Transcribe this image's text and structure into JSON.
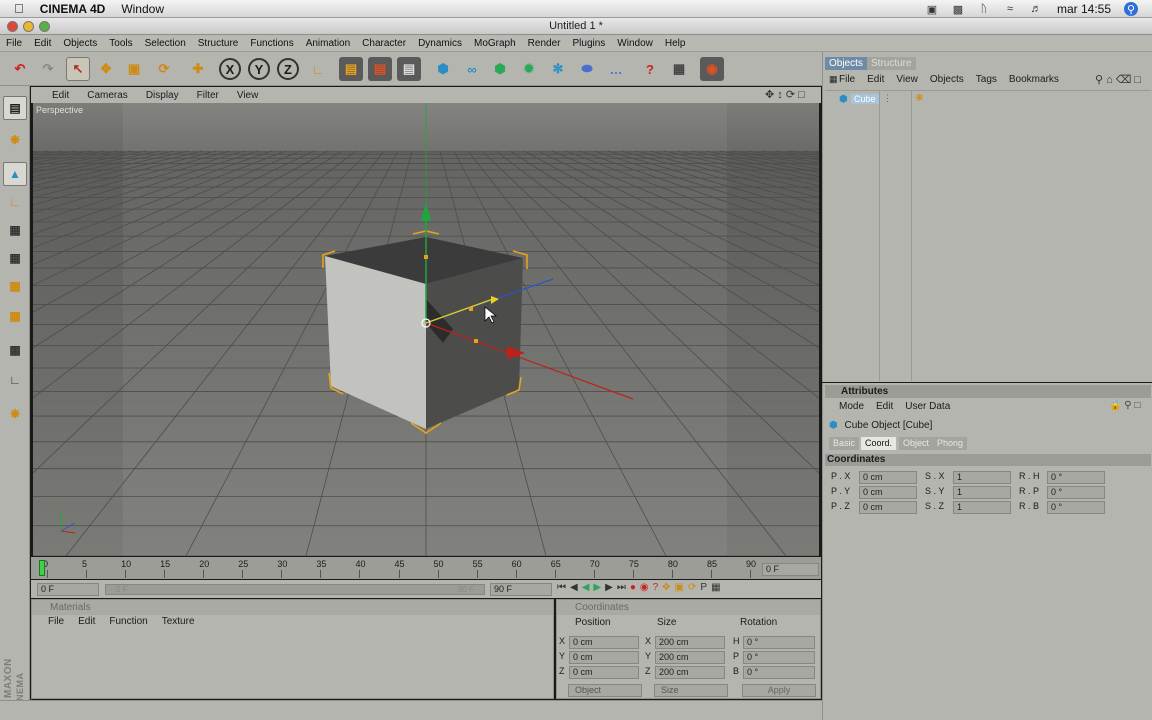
{
  "mac_menubar": {
    "app_name": "CINEMA 4D",
    "menu": "Window",
    "clock": "mar 14:55"
  },
  "window": {
    "title": "Untitled 1 *"
  },
  "app_menu": [
    "File",
    "Edit",
    "Objects",
    "Tools",
    "Selection",
    "Structure",
    "Functions",
    "Animation",
    "Character",
    "Dynamics",
    "MoGraph",
    "Render",
    "Plugins",
    "Window",
    "Help"
  ],
  "viewport": {
    "menu": [
      "Edit",
      "Cameras",
      "Display",
      "Filter",
      "View"
    ],
    "label": "Perspective"
  },
  "timeline": {
    "ticks": [
      "0",
      "5",
      "10",
      "15",
      "20",
      "25",
      "30",
      "35",
      "40",
      "45",
      "50",
      "55",
      "60",
      "65",
      "70",
      "75",
      "80",
      "85",
      "90"
    ],
    "current_frame": "0 F",
    "start_frame": "0 F",
    "end_frame": "90 F",
    "range_start": "0 F",
    "range_end": "90 F"
  },
  "materials_panel": {
    "title": "Materials",
    "menu": [
      "File",
      "Edit",
      "Function",
      "Texture"
    ]
  },
  "coordinates_panel": {
    "title": "Coordinates",
    "col_position": "Position",
    "col_size": "Size",
    "col_rotation": "Rotation",
    "rows": [
      {
        "axis": "X",
        "pos": "0 cm",
        "size_axis": "X",
        "size": "200 cm",
        "rot_axis": "H",
        "rot": "0 °"
      },
      {
        "axis": "Y",
        "pos": "0 cm",
        "size_axis": "Y",
        "size": "200 cm",
        "rot_axis": "P",
        "rot": "0 °"
      },
      {
        "axis": "Z",
        "pos": "0 cm",
        "size_axis": "Z",
        "size": "200 cm",
        "rot_axis": "B",
        "rot": "0 °"
      }
    ],
    "mode_select": "Object",
    "size_select": "Size",
    "apply_label": "Apply"
  },
  "objects_panel": {
    "tab_objects": "Objects",
    "tab_structure": "Structure",
    "menu": [
      "File",
      "Edit",
      "View",
      "Objects",
      "Tags",
      "Bookmarks"
    ],
    "items": [
      {
        "name": "Cube"
      }
    ]
  },
  "attributes_panel": {
    "title": "Attributes",
    "menu": [
      "Mode",
      "Edit",
      "User Data"
    ],
    "object_label": "Cube Object [Cube]",
    "tabs": [
      "Basic",
      "Coord.",
      "Object",
      "Phong"
    ],
    "active_tab": "Coord.",
    "section": "Coordinates",
    "rows": [
      {
        "p_label": "P . X",
        "p_val": "0 cm",
        "s_label": "S . X",
        "s_val": "1",
        "r_label": "R . H",
        "r_val": "0 °"
      },
      {
        "p_label": "P . Y",
        "p_val": "0 cm",
        "s_label": "S . Y",
        "s_val": "1",
        "r_label": "R . P",
        "r_val": "0 °"
      },
      {
        "p_label": "P . Z",
        "p_val": "0 cm",
        "s_label": "S . Z",
        "s_val": "1",
        "r_label": "R . B",
        "r_val": "0 °"
      }
    ]
  },
  "branding": {
    "maxon": "MAXON",
    "c4d": "CINEMA 4D"
  },
  "colors": {
    "ui_gray": "#b4b5ae",
    "viewport_bg": "#6c6d6a",
    "selection_orange": "#e8a21a",
    "axis_x": "#c0201a",
    "axis_y": "#1ca83a",
    "axis_z": "#2a54c8",
    "active_tab": "#e6e7e0"
  }
}
